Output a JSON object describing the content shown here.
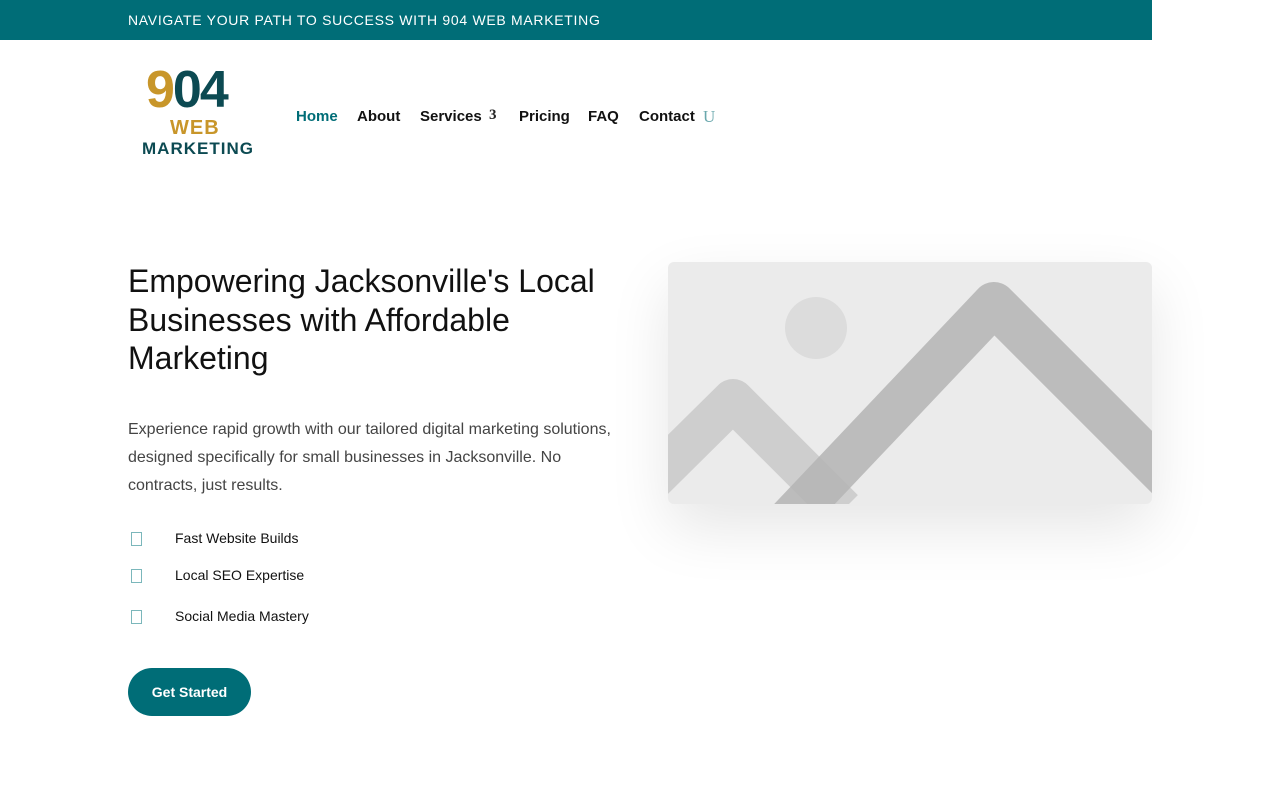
{
  "topbar": {
    "text": "NAVIGATE YOUR PATH TO SUCCESS WITH 904 WEB MARKETING"
  },
  "logo": {
    "digit_nine": "9",
    "digits_04": "04",
    "web": "WEB",
    "marketing": "MARKETING"
  },
  "nav": {
    "items": [
      {
        "label": "Home",
        "active": true
      },
      {
        "label": "About"
      },
      {
        "label": "Services"
      },
      {
        "label": "Pricing"
      },
      {
        "label": "FAQ"
      },
      {
        "label": "Contact"
      }
    ],
    "services_chevron_glyph": "3",
    "search_glyph": "U"
  },
  "hero": {
    "title": "Empowering Jacksonville's Local Businesses with Affordable Marketing",
    "description": "Experience rapid growth with our tailored digital marketing solutions, designed specifically for small businesses in Jacksonville. No contracts, just results.",
    "features": [
      {
        "label": "Fast Website Builds",
        "icon": "checkbox-icon"
      },
      {
        "label": "Local SEO Expertise",
        "icon": "checkbox-icon"
      },
      {
        "label": "Social Media Mastery",
        "icon": "checkbox-icon"
      }
    ],
    "cta_label": "Get Started",
    "image_icon": "image-placeholder-icon"
  },
  "colors": {
    "brand_teal": "#006d77",
    "logo_gold": "#c8962a",
    "logo_dark_teal": "#0c4a52",
    "placeholder_bg": "#ebebeb"
  }
}
